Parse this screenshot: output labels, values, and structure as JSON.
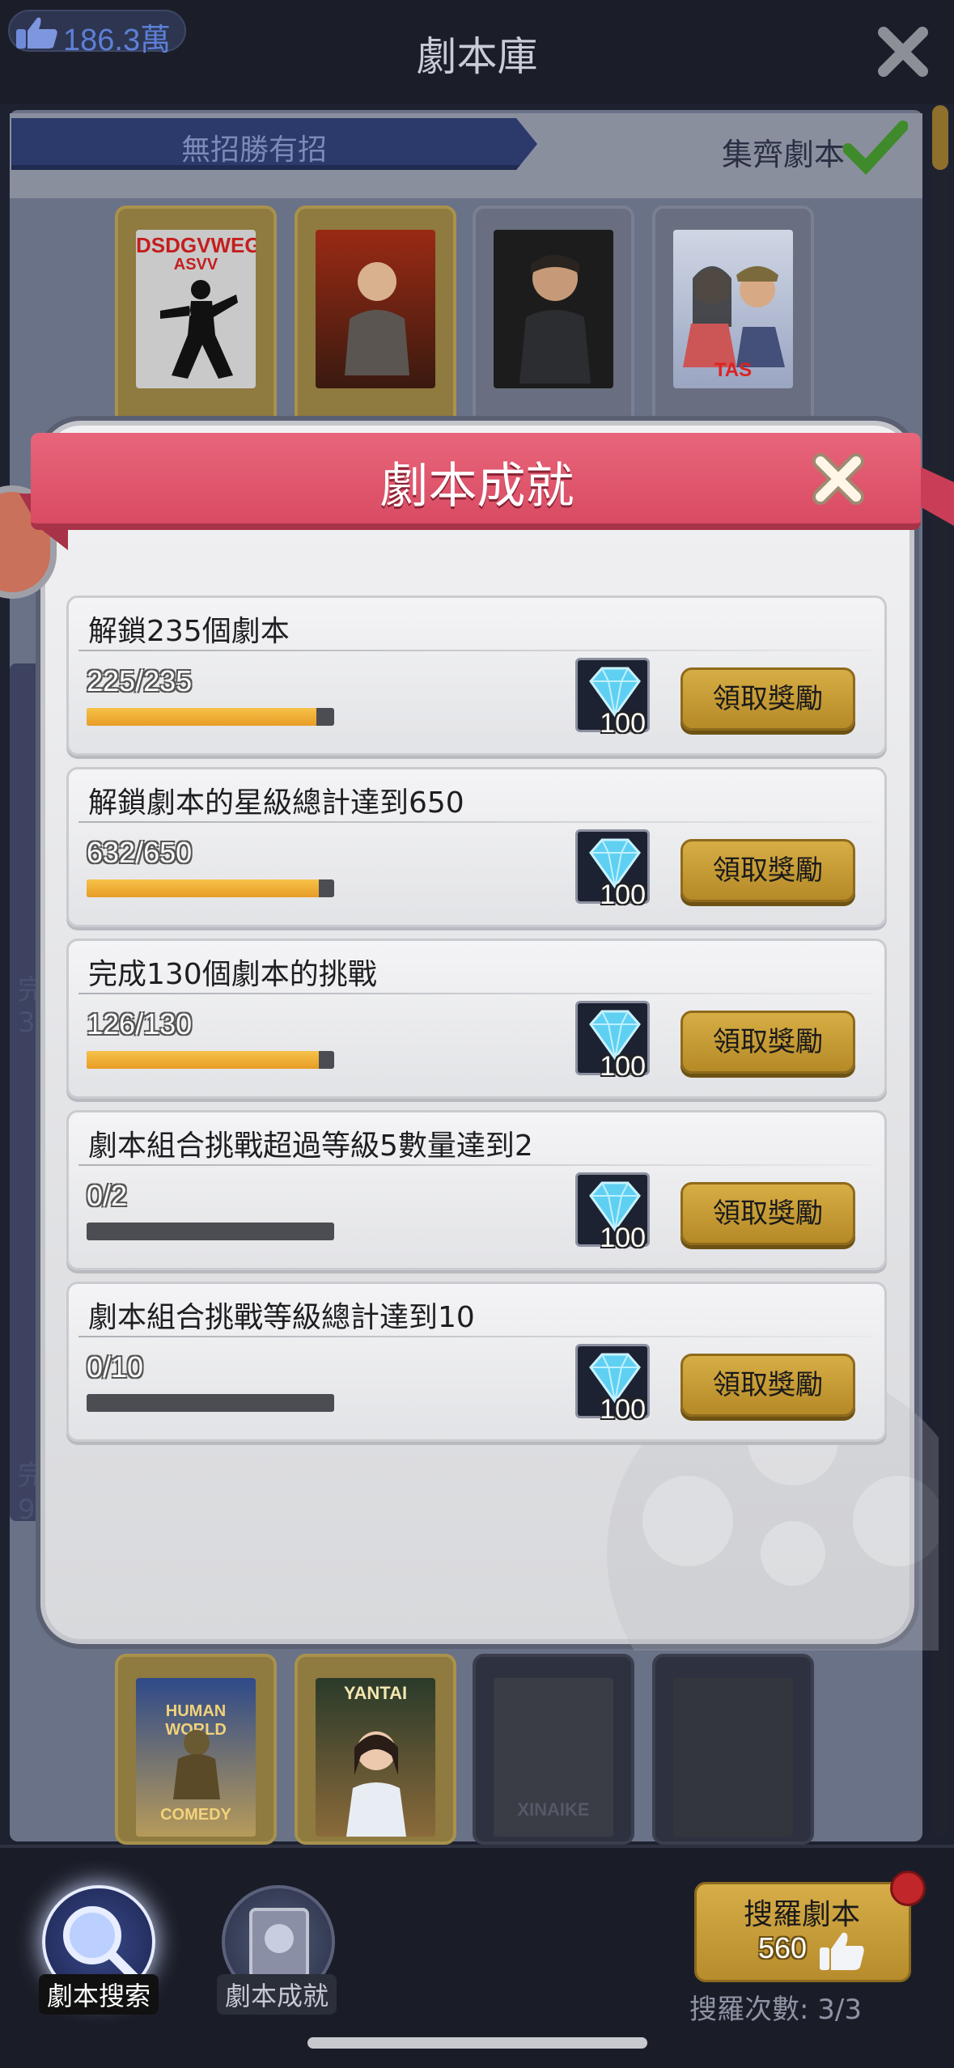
{
  "header": {
    "likes_count": "186.3萬",
    "title": "劇本庫"
  },
  "library": {
    "section_title": "無招勝有招",
    "collect_label": "集齊劇本",
    "posters_top": [
      "DSDGVWEG",
      "ASVV",
      "TAS"
    ],
    "posters_bottom": [
      "HUMAN WORLD",
      "COMEDY",
      "YANTAI",
      "XINAIKE"
    ],
    "side_text_1": "完",
    "side_text_2": "3",
    "side_text_3": "完",
    "side_text_4": "9"
  },
  "modal": {
    "title": "劇本成就",
    "achievements": [
      {
        "name": "解鎖235個劇本",
        "progress": "225/235",
        "ratio": 0.957,
        "reward": "100",
        "button": "領取獎勵"
      },
      {
        "name": "解鎖劇本的星級總計達到650",
        "progress": "632/650",
        "ratio": 0.972,
        "reward": "100",
        "button": "領取獎勵"
      },
      {
        "name": "完成130個劇本的挑戰",
        "progress": "126/130",
        "ratio": 0.969,
        "reward": "100",
        "button": "領取獎勵"
      },
      {
        "name": "劇本組合挑戰超過等級5數量達到2",
        "progress": "0/2",
        "ratio": 0,
        "reward": "100",
        "button": "領取獎勵"
      },
      {
        "name": "劇本組合挑戰等級總計達到10",
        "progress": "0/10",
        "ratio": 0,
        "reward": "100",
        "button": "領取獎勵"
      }
    ]
  },
  "bottom": {
    "tab_search": "劇本搜索",
    "tab_achievements": "劇本成就",
    "search_button": "搜羅劇本",
    "search_cost": "560",
    "search_count": "搜羅次數: 3/3"
  },
  "colors": {
    "banner": "#d94b63",
    "claim_button": "#c99c36",
    "progress_fill": "#f0ae33"
  },
  "icons": [
    "thumbs-up-icon",
    "close-icon",
    "diamond-icon",
    "check-icon",
    "magnifier-icon",
    "book-icon"
  ]
}
